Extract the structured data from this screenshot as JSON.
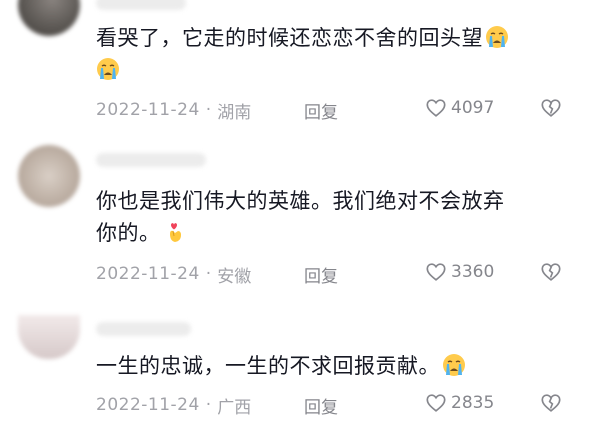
{
  "comments": [
    {
      "text_line1": "看哭了，它走的时候还恋恋不舍的回头望",
      "emoji": "loudly-crying-face",
      "date": "2022-11-24",
      "location": "湖南",
      "reply_label": "回复",
      "likes": "4097"
    },
    {
      "text_line1": "你也是我们伟大的英雄。我们绝对不会放弃",
      "text_line2": "你的。",
      "emoji": "finger-heart",
      "date": "2022-11-24",
      "location": "安徽",
      "reply_label": "回复",
      "likes": "3360"
    },
    {
      "text_line1": "一生的忠诚，一生的不求回报贡献。",
      "emoji": "loudly-crying-face",
      "date": "2022-11-24",
      "location": "广西",
      "reply_label": "回复",
      "likes": "2835"
    }
  ],
  "colors": {
    "text": "#161823",
    "meta": "#a1a2a8",
    "action": "#85868c"
  }
}
